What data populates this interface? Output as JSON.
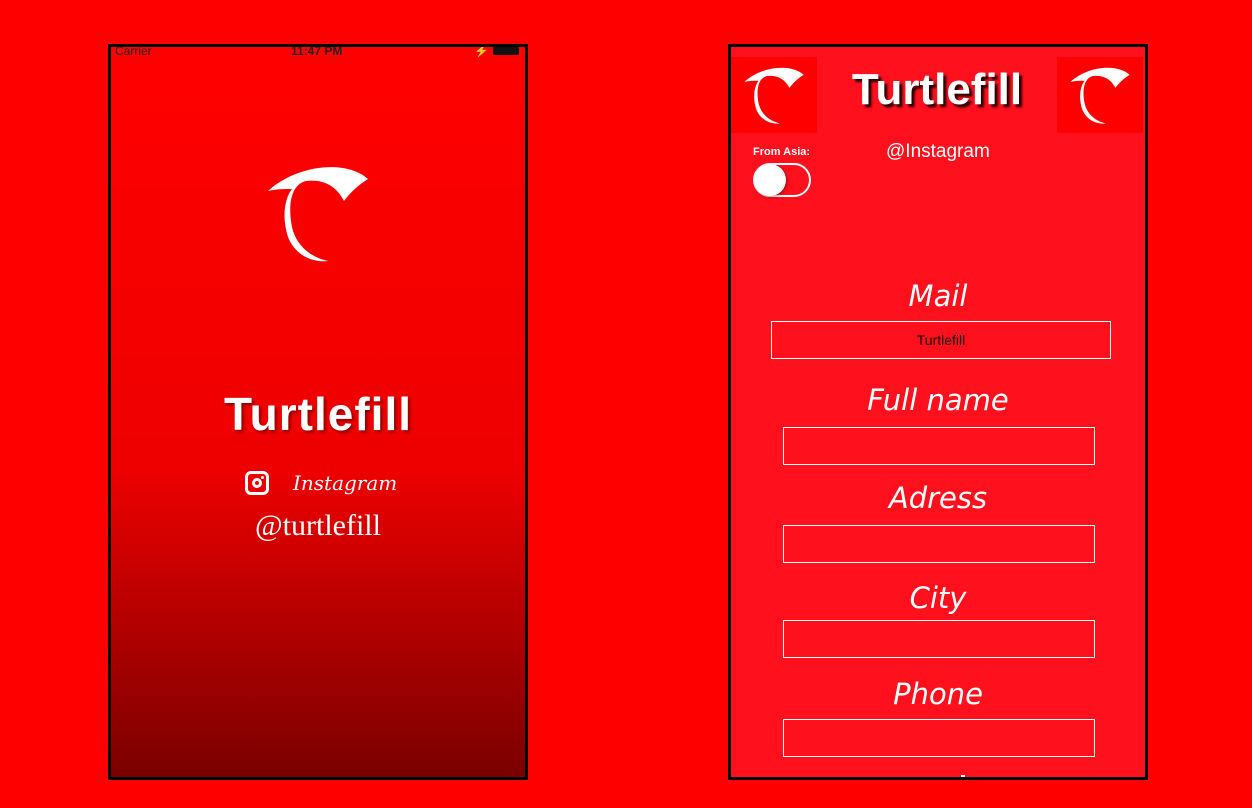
{
  "left_screen": {
    "status": {
      "carrier": "Carrier",
      "time": "11:47 PM"
    },
    "brand": "Turtlefill",
    "instagram_label": "Instagram",
    "handle": "@turtlefill"
  },
  "right_screen": {
    "title": "Turtlefill",
    "from_asia_label": "From Asia:",
    "from_asia_on": false,
    "instagram_handle": "@Instagram",
    "fields": [
      {
        "label": "Mail",
        "value": "Turtlefill"
      },
      {
        "label": "Full name",
        "value": ""
      },
      {
        "label": "Adress",
        "value": ""
      },
      {
        "label": "City",
        "value": ""
      },
      {
        "label": "Phone",
        "value": ""
      }
    ]
  },
  "colors": {
    "background": "#ff0000",
    "form_background": "#ff101c",
    "accent": "#ffffff"
  },
  "icons": [
    "turtlefill-logo-icon",
    "instagram-icon"
  ]
}
